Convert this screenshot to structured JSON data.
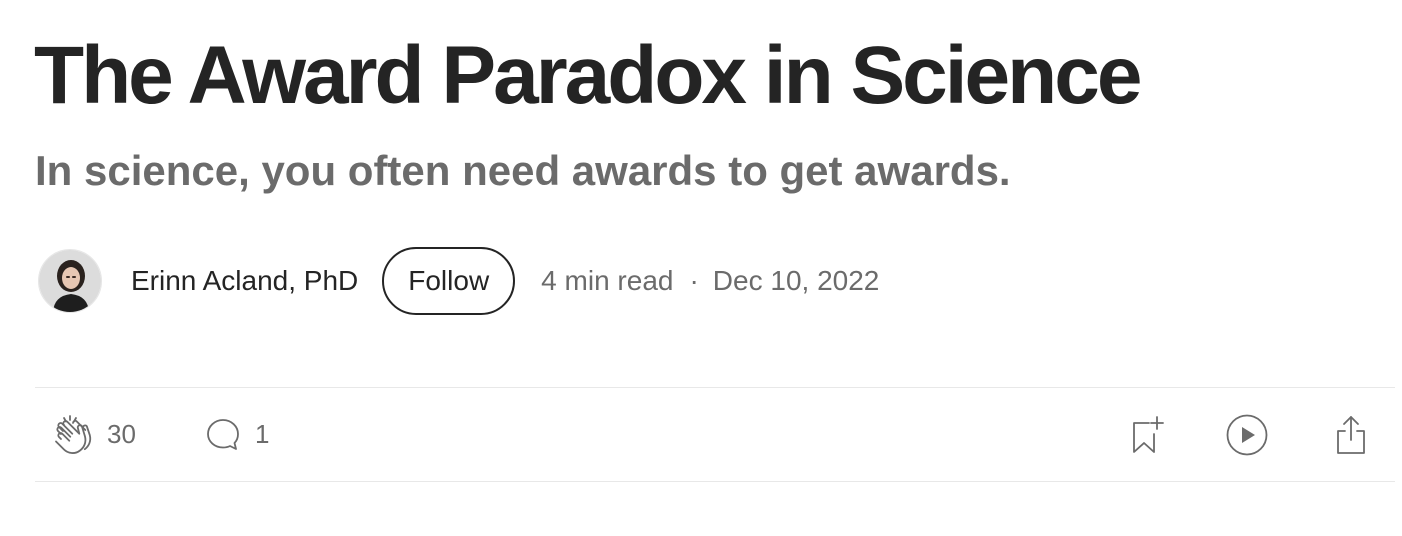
{
  "article": {
    "title": "The Award Paradox in Science",
    "subtitle": "In science, you often need awards to get awards."
  },
  "author": {
    "name": "Erinn Acland, PhD",
    "avatar_icon": "author-avatar-photo"
  },
  "follow_button": {
    "label": "Follow"
  },
  "meta": {
    "read_time": "4 min read",
    "separator": "·",
    "date": "Dec 10, 2022"
  },
  "actions": {
    "clap": {
      "icon": "clap-icon",
      "count": "30"
    },
    "comment": {
      "icon": "comment-icon",
      "count": "1"
    },
    "save": {
      "icon": "bookmark-add-icon"
    },
    "listen": {
      "icon": "play-icon"
    },
    "share": {
      "icon": "share-icon"
    }
  },
  "colors": {
    "text_primary": "#242424",
    "text_secondary": "#6b6b6b",
    "divider": "#e8e8e8"
  }
}
